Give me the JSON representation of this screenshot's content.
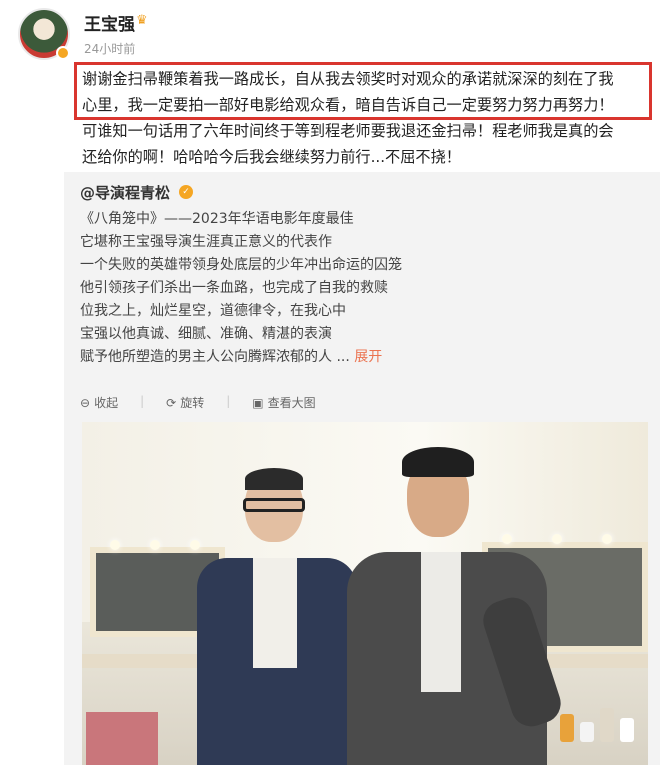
{
  "header": {
    "username": "王宝强",
    "time": "24小时前",
    "crown_icon": "crown-icon"
  },
  "post": {
    "line1": "谢谢金扫帚鞭策着我一路成长，自从我去领奖时对观众的承诺就深深的刻在了我",
    "line2": "心里，我一定要拍一部好电影给观众看，暗自告诉自己一定要努力努力再努力！",
    "line3": "可谁知一句话用了六年时间终于等到程老师要我退还金扫帚！程老师我是真的会",
    "line4": "还给你的啊！哈哈哈今后我会继续努力前行...不屈不挠！"
  },
  "repost": {
    "author": "@导演程青松",
    "lines": [
      "《八角笼中》——2023年华语电影年度最佳",
      "它堪称王宝强导演生涯真正意义的代表作",
      "一个失败的英雄带领身处底层的少年冲出命运的囚笼",
      "他引领孩子们杀出一条血路，也完成了自我的救赎",
      "位我之上，灿烂星空，道德律令，在我心中",
      "宝强以他真诚、细腻、准确、精湛的表演",
      "赋予他所塑造的男主人公向腾辉浓郁的人"
    ],
    "ellipsis": "...",
    "expand": "展开",
    "actions": {
      "collapse": "收起",
      "rotate": "旋转",
      "view_large": "查看大图"
    }
  },
  "colors": {
    "highlight_border": "#d9352e",
    "expand_link": "#eb7350",
    "verify_badge": "#f5a623"
  }
}
